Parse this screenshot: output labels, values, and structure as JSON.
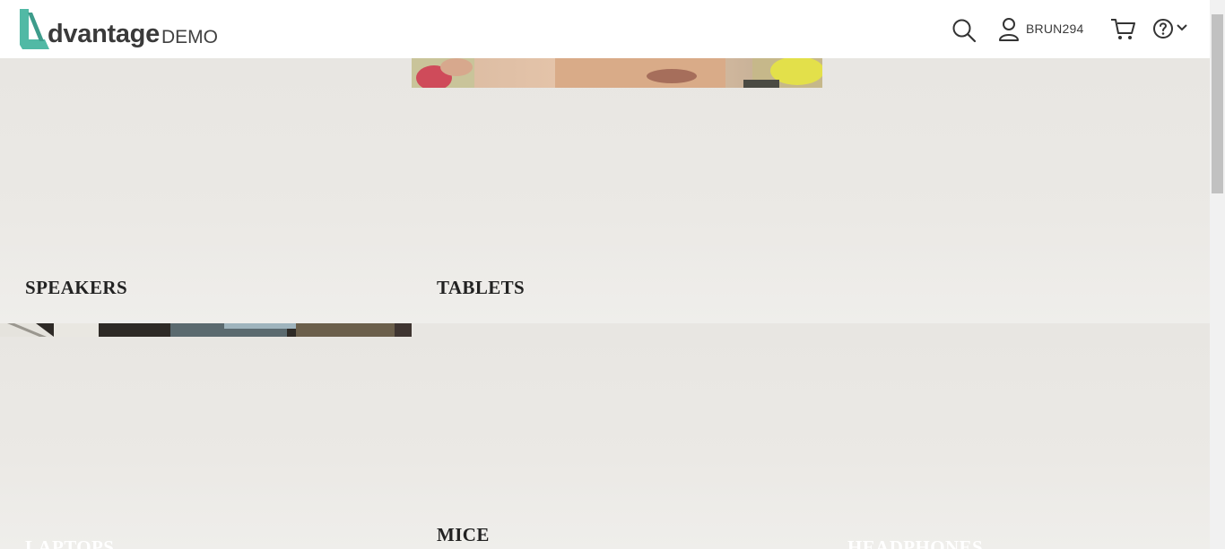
{
  "header": {
    "logo_word": "dvantage",
    "logo_suffix": "DEMO",
    "username": "BRUN294",
    "icons": {
      "search": "search-icon",
      "user": "user-icon",
      "cart": "cart-icon",
      "help": "help-icon",
      "chevron": "chevron-down-icon"
    },
    "logo_color": "#51b9a5"
  },
  "categories": [
    {
      "label": "SPEAKERS"
    },
    {
      "label": "TABLETS"
    },
    {
      "label": "LAPTOPS"
    },
    {
      "label": "MICE"
    },
    {
      "label": "HEADPHONES"
    }
  ]
}
